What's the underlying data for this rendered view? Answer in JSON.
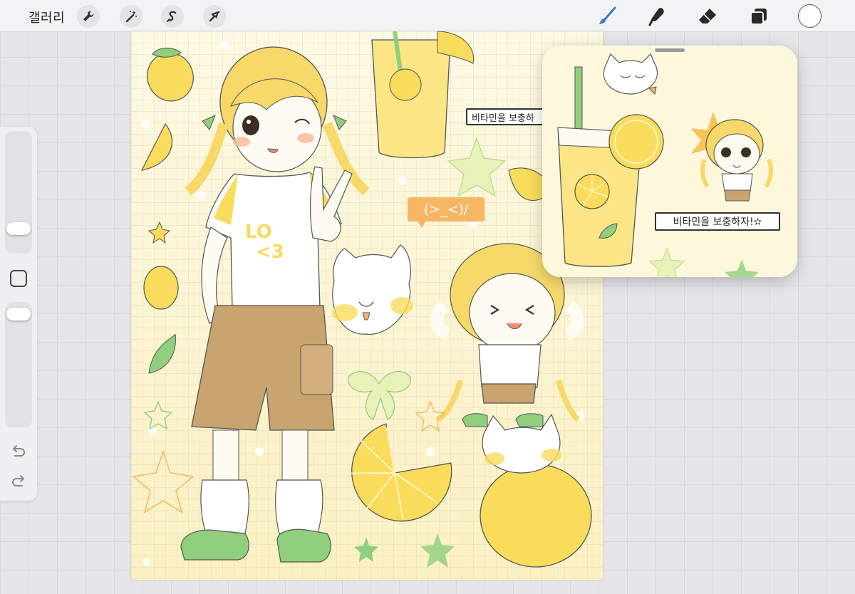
{
  "toolbar": {
    "gallery_label": "갤러리",
    "left_tools": [
      {
        "name": "actions",
        "icon": "wrench-icon"
      },
      {
        "name": "adjustments",
        "icon": "magic-wand-icon"
      },
      {
        "name": "selection",
        "icon": "selection-s-icon"
      },
      {
        "name": "transform",
        "icon": "arrow-cursor-icon"
      }
    ],
    "right_tools": [
      {
        "name": "brush",
        "icon": "brush-icon",
        "active": true
      },
      {
        "name": "smudge",
        "icon": "smudge-icon"
      },
      {
        "name": "eraser",
        "icon": "eraser-icon"
      },
      {
        "name": "layers",
        "icon": "layers-icon"
      }
    ],
    "current_color": "#ffffff",
    "active_color": "#2f7fd8"
  },
  "sidebar": {
    "brush_size_level": 0.12,
    "opacity_level": 0.96,
    "modify_icon": "square-modify-icon",
    "undo_icon": "undo-arrow-icon",
    "redo_icon": "redo-arrow-icon"
  },
  "canvas": {
    "caption": "비타민을 보충하",
    "emote": "(>_<)/"
  },
  "reference": {
    "caption": "비타민을 보충하자!✫"
  },
  "colors": {
    "lemon": "#f9dc5c",
    "pale_yellow": "#fdf7d6",
    "shorts": "#c9a46e",
    "leaf": "#8fcf7d",
    "orange_bubble": "#f7b664"
  }
}
